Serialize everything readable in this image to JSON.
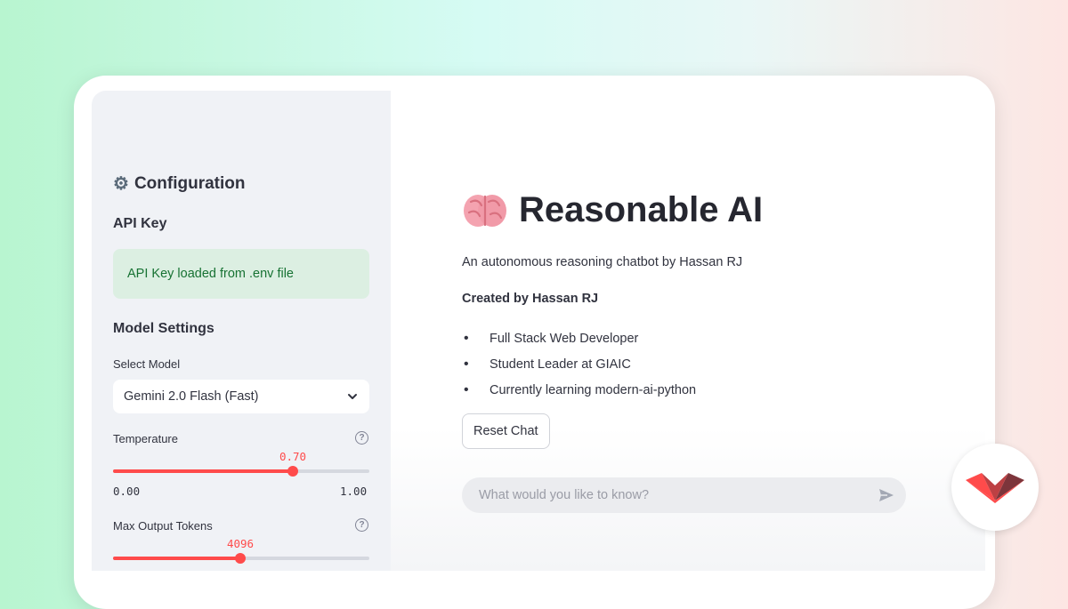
{
  "sidebar": {
    "title": "Configuration",
    "api_key_heading": "API Key",
    "api_key_status": "API Key loaded from .env file",
    "model_settings_heading": "Model Settings",
    "select_model_label": "Select Model",
    "selected_model": "Gemini 2.0 Flash (Fast)",
    "temperature": {
      "label": "Temperature",
      "value": "0.70",
      "min": "0.00",
      "max": "1.00",
      "fraction": 0.7
    },
    "max_tokens": {
      "label": "Max Output Tokens",
      "value": "4096",
      "fraction": 0.495
    }
  },
  "main": {
    "title": "Reasonable AI",
    "subtitle": "An autonomous reasoning chatbot by Hassan RJ",
    "created_by": "Created by Hassan RJ",
    "bullets": [
      "Full Stack Web Developer",
      "Student Leader at GIAIC",
      "Currently learning modern-ai-python"
    ],
    "reset_button": "Reset Chat",
    "chat_placeholder": "What would you like to know?"
  },
  "colors": {
    "accent": "#ff4b4b",
    "success_bg": "#dcefe2",
    "success_text": "#177233",
    "sidebar_bg": "#f0f2f6"
  },
  "icons": {
    "title": "gear-icon",
    "heading": "brain-icon",
    "send": "send-icon",
    "select": "chevron-down-icon",
    "help": "help-circle-icon",
    "badge": "streamlit-logo-icon"
  }
}
